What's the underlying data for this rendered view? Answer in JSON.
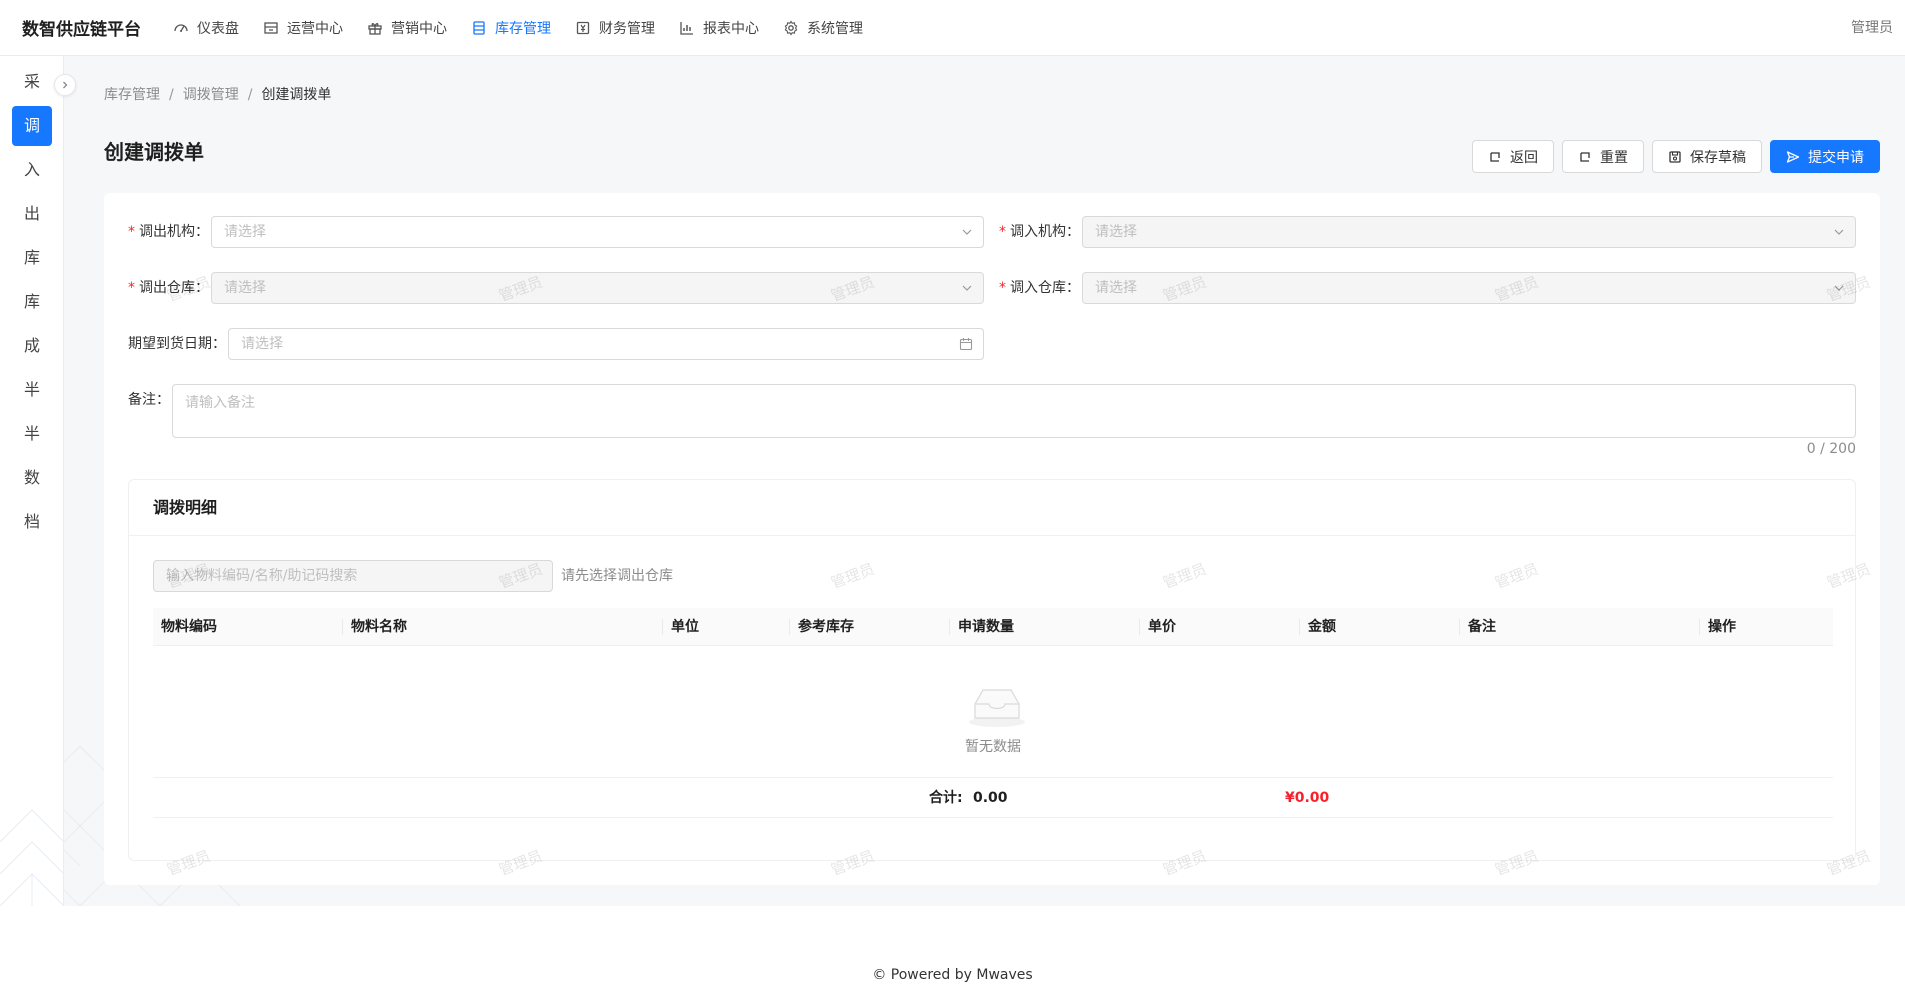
{
  "brand": "数智供应链平台",
  "nav": [
    {
      "label": "仪表盘",
      "icon": "dashboard-icon"
    },
    {
      "label": "运营中心",
      "icon": "store-icon"
    },
    {
      "label": "营销中心",
      "icon": "gift-icon"
    },
    {
      "label": "库存管理",
      "icon": "database-icon"
    },
    {
      "label": "财务管理",
      "icon": "account-book-icon"
    },
    {
      "label": "报表中心",
      "icon": "bar-chart-icon"
    },
    {
      "label": "系统管理",
      "icon": "gear-icon"
    }
  ],
  "user": "管理员",
  "sidebar": [
    "采",
    "调",
    "入",
    "出",
    "库",
    "库",
    "成",
    "半",
    "半",
    "数",
    "档"
  ],
  "breadcrumb": {
    "level1": "库存管理",
    "level2": "调拨管理",
    "current": "创建调拨单",
    "separator": "/"
  },
  "page_title": "创建调拨单",
  "actions": {
    "back": "返回",
    "reset": "重置",
    "save_draft": "保存草稿",
    "submit": "提交申请"
  },
  "form": {
    "out_org_label": "调出机构：",
    "out_org_placeholder": "请选择",
    "in_org_label": "调入机构：",
    "in_org_placeholder": "请选择",
    "out_wh_label": "调出仓库：",
    "out_wh_placeholder": "请选择",
    "in_wh_label": "调入仓库：",
    "in_wh_placeholder": "请选择",
    "date_label": "期望到货日期：",
    "date_placeholder": "请选择",
    "remark_label": "备注：",
    "remark_placeholder": "请输入备注",
    "remark_counter": "0 / 200",
    "required_mark": "*"
  },
  "detail": {
    "title": "调拨明细",
    "search_placeholder": "输入物料编码/名称/助记码搜索",
    "hint": "请先选择调出仓库",
    "columns": [
      "物料编码",
      "物料名称",
      "单位",
      "参考库存",
      "申请数量",
      "单价",
      "金额",
      "备注",
      "操作"
    ],
    "empty_text": "暂无数据",
    "sum_label": "合计:",
    "sum_qty": "0.00",
    "sum_amount": "¥0.00"
  },
  "watermark": "管理员",
  "footer": "Powered by Mwaves",
  "colors": {
    "primary": "#1677ff",
    "danger": "#f5222d"
  }
}
